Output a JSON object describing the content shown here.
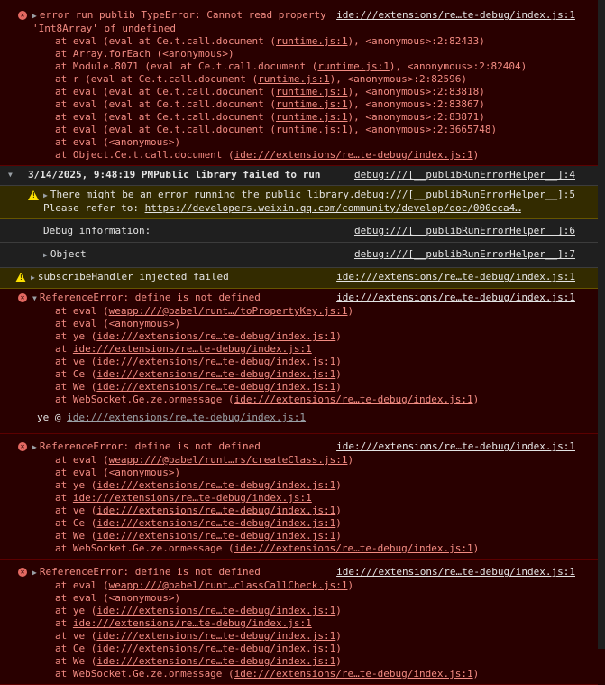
{
  "m1": {
    "title": "error run publib TypeError: Cannot read property",
    "title2": "'Int8Array' of undefined",
    "source": "ide:///extensions/re…te-debug/index.js:1",
    "frames": [
      {
        "pre": "at eval (eval at Ce.t.call.document (",
        "link": "runtime.js:1",
        "post": "), <anonymous>:2:82433)"
      },
      {
        "pre": "at Array.forEach (<anonymous>)",
        "link": "",
        "post": ""
      },
      {
        "pre": "at Module.8071 (eval at Ce.t.call.document (",
        "link": "runtime.js:1",
        "post": "), <anonymous>:2:82404)"
      },
      {
        "pre": "at r (eval at Ce.t.call.document (",
        "link": "runtime.js:1",
        "post": "), <anonymous>:2:82596)"
      },
      {
        "pre": "at eval (eval at Ce.t.call.document (",
        "link": "runtime.js:1",
        "post": "), <anonymous>:2:83818)"
      },
      {
        "pre": "at eval (eval at Ce.t.call.document (",
        "link": "runtime.js:1",
        "post": "), <anonymous>:2:83867)"
      },
      {
        "pre": "at eval (eval at Ce.t.call.document (",
        "link": "runtime.js:1",
        "post": "), <anonymous>:2:83871)"
      },
      {
        "pre": "at eval (eval at Ce.t.call.document (",
        "link": "runtime.js:1",
        "post": "), <anonymous>:2:3665748)"
      },
      {
        "pre": "at eval (<anonymous>)",
        "link": "",
        "post": ""
      },
      {
        "pre": "at Object.Ce.t.call.document (",
        "link": "ide:///extensions/re…te-debug/index.js:1",
        "post": ")"
      }
    ]
  },
  "group": {
    "title": "3/14/2025, 9:48:19 PMPublic library failed to run",
    "source": "debug:///[__publibRunErrorHelper__]:4",
    "warn_text": "There might be an error running the public library.",
    "warn_source": "debug:///[__publibRunErrorHelper__]:5",
    "refer_prefix": "Please refer to: ",
    "refer_link": "https://developers.weixin.qq.com/community/develop/doc/000cca4…",
    "debug_label": "Debug information:",
    "debug_source": "debug:///[__publibRunErrorHelper__]:6",
    "object_label": "Object",
    "object_source": "debug:///[__publibRunErrorHelper__]:7"
  },
  "m2": {
    "title": "subscribeHandler injected failed",
    "source": "ide:///extensions/re…te-debug/index.js:1"
  },
  "m3": {
    "title": "ReferenceError: define is not defined",
    "source": "ide:///extensions/re…te-debug/index.js:1",
    "frames": [
      {
        "pre": "at eval (",
        "link": "weapp:///@babel/runt…/toPropertyKey.js:1",
        "post": ")"
      },
      {
        "pre": "at eval (<anonymous>)",
        "link": "",
        "post": ""
      },
      {
        "pre": "at ye (",
        "link": "ide:///extensions/re…te-debug/index.js:1",
        "post": ")"
      },
      {
        "pre": "at ",
        "link": "ide:///extensions/re…te-debug/index.js:1",
        "post": ""
      },
      {
        "pre": "at ve (",
        "link": "ide:///extensions/re…te-debug/index.js:1",
        "post": ")"
      },
      {
        "pre": "at Ce (",
        "link": "ide:///extensions/re…te-debug/index.js:1",
        "post": ")"
      },
      {
        "pre": "at We (",
        "link": "ide:///extensions/re…te-debug/index.js:1",
        "post": ")"
      },
      {
        "pre": "at WebSocket.Ge.ze.onmessage (",
        "link": "ide:///extensions/re…te-debug/index.js:1",
        "post": ")"
      }
    ],
    "caller_prefix": "ye @ ",
    "caller_link": "ide:///extensions/re…te-debug/index.js:1"
  },
  "m4": {
    "title": "ReferenceError: define is not defined",
    "source": "ide:///extensions/re…te-debug/index.js:1",
    "frames": [
      {
        "pre": "at eval (",
        "link": "weapp:///@babel/runt…rs/createClass.js:1",
        "post": ")"
      },
      {
        "pre": "at eval (<anonymous>)",
        "link": "",
        "post": ""
      },
      {
        "pre": "at ye (",
        "link": "ide:///extensions/re…te-debug/index.js:1",
        "post": ")"
      },
      {
        "pre": "at ",
        "link": "ide:///extensions/re…te-debug/index.js:1",
        "post": ""
      },
      {
        "pre": "at ve (",
        "link": "ide:///extensions/re…te-debug/index.js:1",
        "post": ")"
      },
      {
        "pre": "at Ce (",
        "link": "ide:///extensions/re…te-debug/index.js:1",
        "post": ")"
      },
      {
        "pre": "at We (",
        "link": "ide:///extensions/re…te-debug/index.js:1",
        "post": ")"
      },
      {
        "pre": "at WebSocket.Ge.ze.onmessage (",
        "link": "ide:///extensions/re…te-debug/index.js:1",
        "post": ")"
      }
    ]
  },
  "m5": {
    "title": "ReferenceError: define is not defined",
    "source": "ide:///extensions/re…te-debug/index.js:1",
    "frames": [
      {
        "pre": "at eval (",
        "link": "weapp:///@babel/runt…classCallCheck.js:1",
        "post": ")"
      },
      {
        "pre": "at eval (<anonymous>)",
        "link": "",
        "post": ""
      },
      {
        "pre": "at ye (",
        "link": "ide:///extensions/re…te-debug/index.js:1",
        "post": ")"
      },
      {
        "pre": "at ",
        "link": "ide:///extensions/re…te-debug/index.js:1",
        "post": ""
      },
      {
        "pre": "at ve (",
        "link": "ide:///extensions/re…te-debug/index.js:1",
        "post": ")"
      },
      {
        "pre": "at Ce (",
        "link": "ide:///extensions/re…te-debug/index.js:1",
        "post": ")"
      },
      {
        "pre": "at We (",
        "link": "ide:///extensions/re…te-debug/index.js:1",
        "post": ")"
      },
      {
        "pre": "at WebSocket.Ge.ze.onmessage (",
        "link": "ide:///extensions/re…te-debug/index.js:1",
        "post": ")"
      }
    ]
  },
  "icons": {
    "error": "error-icon",
    "warning": "warning-icon",
    "expand": "expand-triangle-icon",
    "collapse": "collapse-triangle-icon"
  },
  "colors": {
    "error_bg": "#290000",
    "error_text": "#f28b82",
    "warn_bg": "#332b00",
    "warn_text": "#fce100",
    "group_bg": "#1f1f1f"
  }
}
